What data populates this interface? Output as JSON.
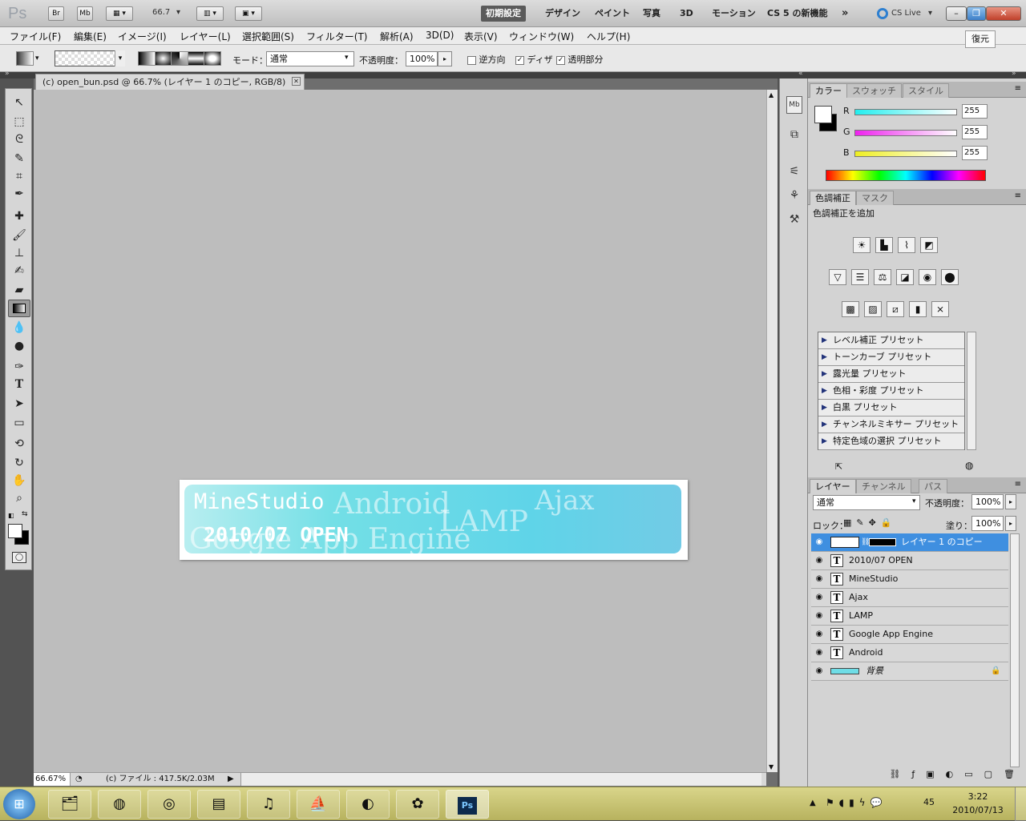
{
  "appbar": {
    "logo": "Ps",
    "br": "Br",
    "mb": "Mb",
    "zoom": "66.7",
    "workspaces": [
      "初期設定",
      "デザイン",
      "ペイント",
      "写真",
      "3D",
      "モーション",
      "CS 5 の新機能"
    ],
    "more": "»",
    "cslive": "CS Live",
    "tooltip": "復元"
  },
  "menu": [
    "ファイル(F)",
    "編集(E)",
    "イメージ(I)",
    "レイヤー(L)",
    "選択範囲(S)",
    "フィルター(T)",
    "解析(A)",
    "3D(D)",
    "表示(V)",
    "ウィンドウ(W)",
    "ヘルプ(H)"
  ],
  "options": {
    "mode_label": "モード：",
    "mode_value": "通常",
    "opacity_label": "不透明度：",
    "opacity_value": "100%",
    "reverse": "逆方向",
    "dither": "ディザ",
    "transparency": "透明部分"
  },
  "document": {
    "tab": "(c) open_bun.psd @ 66.7% (レイヤー 1 のコピー, RGB/8)",
    "zoom": "66.67%",
    "file_info": "(c) ファイル : 417.5K/2.03M"
  },
  "banner": {
    "brand": "MineStudio",
    "open": "2010/07 OPEN",
    "words": [
      "Android",
      "LAMP",
      "Ajax",
      "Google App Engine"
    ]
  },
  "color_panel": {
    "tabs": [
      "カラー",
      "スウォッチ",
      "スタイル"
    ],
    "r_label": "R",
    "g_label": "G",
    "b_label": "B",
    "r": "255",
    "g": "255",
    "b": "255"
  },
  "adjust_panel": {
    "tabs": [
      "色調補正",
      "マスク"
    ],
    "title": "色調補正を追加",
    "presets": [
      "レベル補正 プリセット",
      "トーンカーブ プリセット",
      "露光量 プリセット",
      "色相・彩度 プリセット",
      "白黒 プリセット",
      "チャンネルミキサー プリセット",
      "特定色域の選択 プリセット"
    ]
  },
  "layers_panel": {
    "tabs": [
      "レイヤー",
      "チャンネル",
      "パス"
    ],
    "blend": "通常",
    "opacity_label": "不透明度：",
    "opacity": "100%",
    "lock_label": "ロック：",
    "fill_label": "塗り：",
    "fill": "100%",
    "layers": [
      "レイヤー 1 のコピー",
      "2010/07 OPEN",
      "MineStudio",
      "Ajax",
      "LAMP",
      "Google App Engine",
      "Android",
      "背景"
    ]
  },
  "taskbar": {
    "time": "3:22",
    "date": "2010/07/13",
    "tray_text": "45"
  }
}
